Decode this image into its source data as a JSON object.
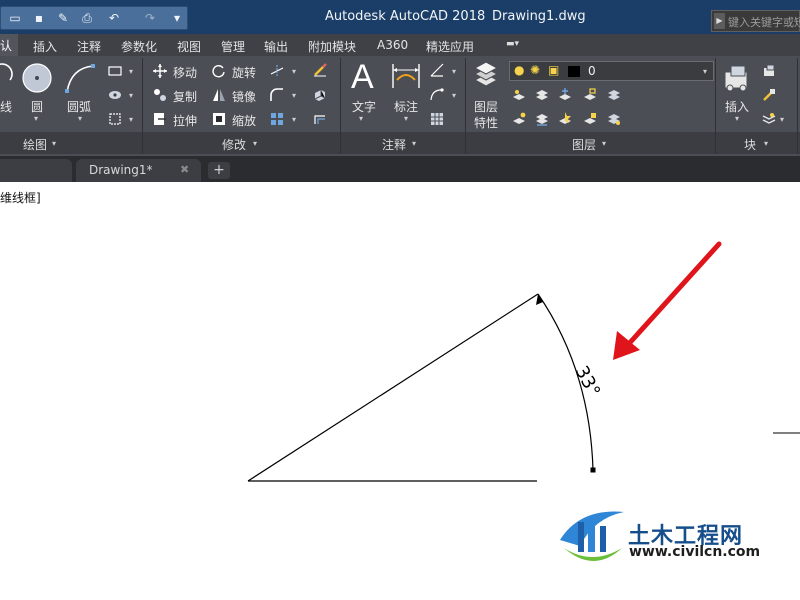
{
  "window": {
    "app_title": "Autodesk AutoCAD 2018",
    "file_title": "Drawing1.dwg",
    "search_placeholder": "键入关键字或短语"
  },
  "quick_access": {
    "icons": [
      "open-icon",
      "save-icon",
      "saveas-icon",
      "print-icon",
      "undo-icon",
      "redo-icon",
      "customize-icon"
    ],
    "glyphs": {
      "open": "▭",
      "save": "▪",
      "saveas": "✎",
      "print": "⎙",
      "undo": "↶",
      "redo": "↷",
      "more": "▾"
    }
  },
  "ribbon_tabs": {
    "default_partial": "认",
    "insert": "插入",
    "annotate": "注释",
    "parametric": "参数化",
    "view": "视图",
    "manage": "管理",
    "output": "输出",
    "addins": "附加模块",
    "a360": "A360",
    "featured": "精选应用"
  },
  "draw_panel": {
    "polyline_partial": "线",
    "circle": "圆",
    "arc": "圆弧",
    "title": "绘图"
  },
  "modify_panel": {
    "move": "移动",
    "rotate": "旋转",
    "copy": "复制",
    "mirror": "镜像",
    "stretch": "拉伸",
    "scale": "缩放",
    "title": "修改"
  },
  "annotation_panel": {
    "text_glyph": "A",
    "text": "文字",
    "dimension": "标注",
    "title": "注释"
  },
  "layers_panel": {
    "layer_properties_line1": "图层",
    "layer_properties_line2": "特性",
    "current_layer": "0",
    "title": "图层"
  },
  "block_panel": {
    "insert": "插入",
    "title": "块"
  },
  "document_tabs": {
    "active": "Drawing1*",
    "close": "✖",
    "add": "+"
  },
  "viewport": {
    "label_partial": "维线框]"
  },
  "drawing": {
    "dimension_text": "33°"
  },
  "watermark": {
    "name": "土木工程网",
    "url": "www.civilcn.com"
  },
  "colors": {
    "title_bar": "#1a3e67",
    "ribbon": "#4b4e55",
    "tab_bar": "#3f4147",
    "canvas": "#ffffff",
    "arrow_red": "#e0141b",
    "watermark_blue": "#164e8c"
  }
}
